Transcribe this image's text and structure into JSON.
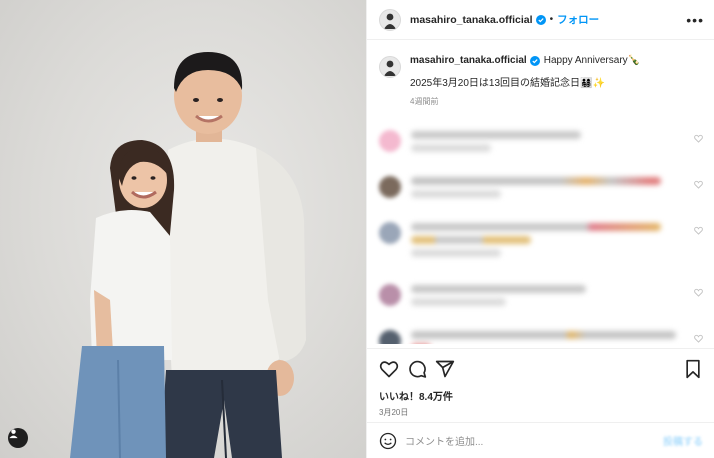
{
  "post": {
    "username": "masahiro_tanaka.official",
    "dot": "•",
    "follow_label": "フォロー",
    "more_label": "•••",
    "caption_line1": "Happy Anniversary🍾",
    "caption_line2": "2025年3月20日は13回目の結婚記念日👨‍👩‍👧‍👦✨",
    "caption_time": "4週間前",
    "likes": "いいね！8.4万件",
    "date": "3月20日",
    "add_comment_placeholder": "コメントを追加...",
    "post_button": "投稿する"
  },
  "comments": [
    {
      "avatar_color": "#f4b9cf",
      "bar1": "#c9c9c9",
      "bar2": "#dcdcdc",
      "accent": "#e8a9c1"
    },
    {
      "avatar_color": "#7b6a5d",
      "bar1": "#c3c3c3",
      "bar2": "#dcdcdc",
      "accent": "#e6b16a"
    },
    {
      "avatar_color": "#9aa6b8",
      "bar1": "#c8c8c8",
      "bar2": "#e2c07a",
      "accent": "#e07d8c"
    },
    {
      "avatar_color": "#b98fa9",
      "bar1": "#c7c7c7",
      "bar2": "#dcdcdc",
      "accent": "#cfcfcf"
    },
    {
      "avatar_color": "#55606e",
      "bar1": "#c4c4c4",
      "bar2": "#e07d7d",
      "accent": "#e3b564"
    }
  ],
  "icons": [
    "heart-icon",
    "comment-icon",
    "share-icon",
    "bookmark-icon",
    "verified-badge-icon",
    "smile-icon",
    "user-tag-icon"
  ],
  "colors": {
    "accent": "#0095f6",
    "verified": "#0095f6",
    "text": "#262626",
    "muted": "#8e8e8e"
  }
}
